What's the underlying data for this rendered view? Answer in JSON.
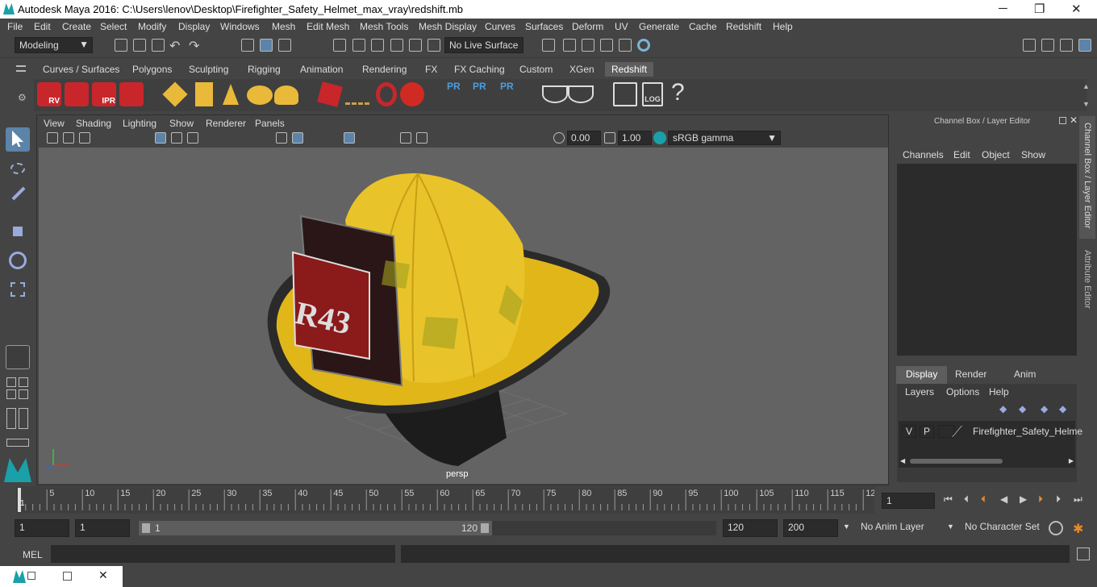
{
  "window": {
    "title": "Autodesk Maya 2016: C:\\Users\\lenov\\Desktop\\Firefighter_Safety_Helmet_max_vray\\redshift.mb",
    "minimize": "─",
    "maximize": "❐",
    "close": "✕"
  },
  "menu": [
    "File",
    "Edit",
    "Create",
    "Select",
    "Modify",
    "Display",
    "Windows",
    "Mesh",
    "Edit Mesh",
    "Mesh Tools",
    "Mesh Display",
    "Curves",
    "Surfaces",
    "Deform",
    "UV",
    "Generate",
    "Cache",
    "Redshift",
    "Help"
  ],
  "status": {
    "mode": "Modeling",
    "live_surface": "No Live Surface"
  },
  "shelf": {
    "tabs": [
      "Curves / Surfaces",
      "Polygons",
      "Sculpting",
      "Rigging",
      "Animation",
      "Rendering",
      "FX",
      "FX Caching",
      "Custom",
      "XGen",
      "Redshift"
    ],
    "active": "Redshift",
    "rs_labels": [
      "RV",
      "",
      "IPR",
      ""
    ],
    "pr_labels": [
      "PR",
      "PR",
      "PR"
    ],
    "help": "?",
    "log": "LOG"
  },
  "viewport": {
    "menus": [
      "View",
      "Shading",
      "Lighting",
      "Show",
      "Renderer",
      "Panels"
    ],
    "exposure": "0.00",
    "gamma": "1.00",
    "colorspace": "sRGB gamma",
    "camera": "persp",
    "badge": "R43"
  },
  "panel": {
    "title": "Channel Box / Layer Editor",
    "menus": [
      "Channels",
      "Edit",
      "Object",
      "Show"
    ],
    "layer_tabs": [
      "Display",
      "Render",
      "Anim"
    ],
    "layer_menus": [
      "Layers",
      "Options",
      "Help"
    ],
    "layer": {
      "v": "V",
      "p": "P",
      "name": "Firefighter_Safety_Helme"
    },
    "side_tabs": [
      "Channel Box / Layer Editor",
      "Attribute Editor"
    ]
  },
  "timeline": {
    "ticks": [
      "5",
      "10",
      "15",
      "20",
      "25",
      "30",
      "35",
      "40",
      "45",
      "50",
      "55",
      "60",
      "65",
      "70",
      "75",
      "80",
      "85",
      "90",
      "95",
      "100",
      "105",
      "110",
      "115",
      "12"
    ],
    "current": "1",
    "start_marker": "1"
  },
  "range": {
    "start": "1",
    "current": "1",
    "slider_start": "1",
    "slider_end": "120",
    "end": "120",
    "max_end": "200",
    "anim_layer": "No Anim Layer",
    "char_set": "No Character Set"
  },
  "cmd": {
    "label": "MEL"
  }
}
